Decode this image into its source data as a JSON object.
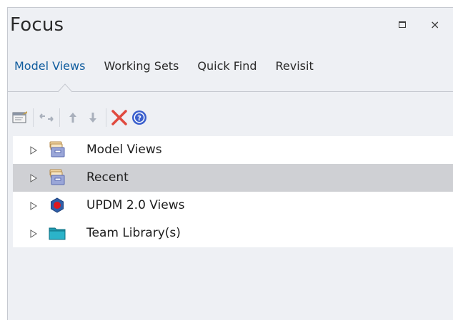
{
  "window": {
    "title": "Focus",
    "maximize_icon": "maximize-icon",
    "close_symbol": "×"
  },
  "tabs": [
    {
      "label": "Model Views",
      "active": true
    },
    {
      "label": "Working Sets",
      "active": false
    },
    {
      "label": "Quick Find",
      "active": false
    },
    {
      "label": "Revisit",
      "active": false
    }
  ],
  "toolbar": [
    {
      "icon": "properties-icon"
    },
    {
      "icon": "sync-icon",
      "disabled": true
    },
    {
      "icon": "move-up-icon",
      "disabled": true
    },
    {
      "icon": "move-down-icon",
      "disabled": true
    },
    {
      "icon": "delete-icon",
      "color": "#e04a3f"
    },
    {
      "icon": "help-icon",
      "color": "#3a5fcd"
    }
  ],
  "tree": [
    {
      "label": "Model Views",
      "icon": "model-views-icon",
      "selected": false
    },
    {
      "label": "Recent",
      "icon": "recent-icon",
      "selected": true
    },
    {
      "label": "UPDM 2.0 Views",
      "icon": "updm-icon",
      "selected": false
    },
    {
      "label": "Team Library(s)",
      "icon": "team-library-folder-icon",
      "selected": false
    }
  ],
  "colors": {
    "panel_bg": "#eef0f4",
    "selected_row": "#cfd0d4",
    "active_tab": "#0f5c9e",
    "updm_hex": "#2e5ea8",
    "updm_dot": "#e0191f",
    "folder_teal": "#1f9bb0"
  }
}
